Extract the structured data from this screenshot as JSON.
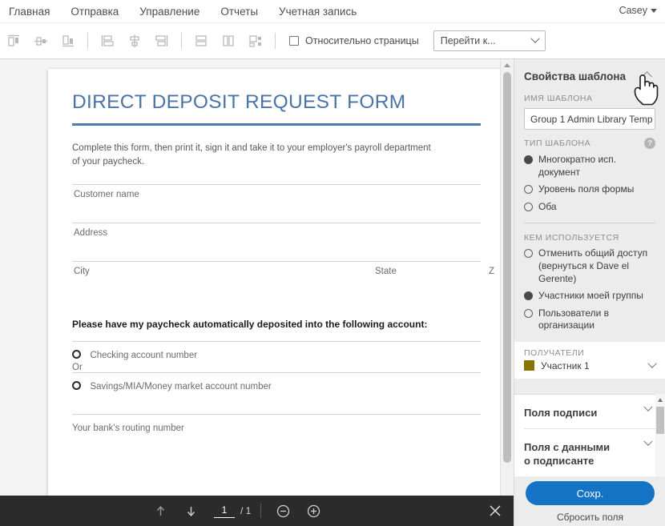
{
  "topnav": {
    "items": [
      {
        "label": "Главная"
      },
      {
        "label": "Отправка"
      },
      {
        "label": "Управление"
      },
      {
        "label": "Отчеты"
      },
      {
        "label": "Учетная запись"
      }
    ],
    "user": "Casey"
  },
  "toolbar": {
    "icons": [
      "align-top-icon",
      "align-middle-horizontal-icon",
      "align-bottom-icon",
      "align-left-icon",
      "align-center-icon",
      "align-right-icon",
      "distribute-vertical-icon",
      "match-width-icon",
      "match-size-icon"
    ],
    "relative_checkbox_label": "Относительно страницы",
    "goto_select_value": "Перейти к..."
  },
  "document": {
    "title": "DIRECT DEPOSIT REQUEST FORM",
    "intro_line1": "Complete this form, then print it, sign it and take it to your employer's payroll department",
    "intro_line2": "of your paycheck.",
    "fields": [
      {
        "label": "Customer name"
      },
      {
        "label": "Address"
      }
    ],
    "city_row": {
      "city": "City",
      "state": "State",
      "zip": "Z"
    },
    "instruction": "Please have my paycheck automatically deposited into the following account:",
    "option1": "Checking account number",
    "or": "Or",
    "option2": "Savings/MIA/Money market account number",
    "routing": "Your bank's routing number"
  },
  "bottombar": {
    "prev_page_icon": "arrow-up-icon",
    "next_page_icon": "arrow-down-icon",
    "current_page": "1",
    "page_separator": "/ 1",
    "zoom_out_icon": "zoom-out-icon",
    "zoom_in_icon": "zoom-in-icon",
    "close_icon": "close-icon"
  },
  "rightpanel": {
    "title": "Свойства шаблона",
    "collapse_icon": "chevron-up-icon",
    "template_name_label": "ИМЯ ШАБЛОНА",
    "template_name_value": "Group 1 Admin Library Temp",
    "template_type_label": "ТИП ШАБЛОНА",
    "help_icon": "question-mark-icon",
    "template_type_options": [
      {
        "label": "Многократно исп. документ",
        "selected": true
      },
      {
        "label": "Уровень поля формы",
        "selected": false
      },
      {
        "label": "Оба",
        "selected": false
      }
    ],
    "used_by_label": "КЕМ ИСПОЛЬЗУЕТСЯ",
    "used_by_options": [
      {
        "label": "Отменить общий доступ (вернуться к Dave el Gerente)",
        "selected": false
      },
      {
        "label": "Участники моей группы",
        "selected": true
      },
      {
        "label": "Пользователи в организации",
        "selected": false
      }
    ],
    "recipients_label": "ПОЛУЧАТЕЛИ",
    "recipient_name": "Участник 1",
    "recipient_color": "#8a7303",
    "field_groups": [
      {
        "label": "Поля подписи"
      },
      {
        "label": "Поля с данными о подписанте"
      }
    ],
    "save_label": "Сохр.",
    "reset_label": "Сбросить поля",
    "accent_color": "#1473c4"
  }
}
